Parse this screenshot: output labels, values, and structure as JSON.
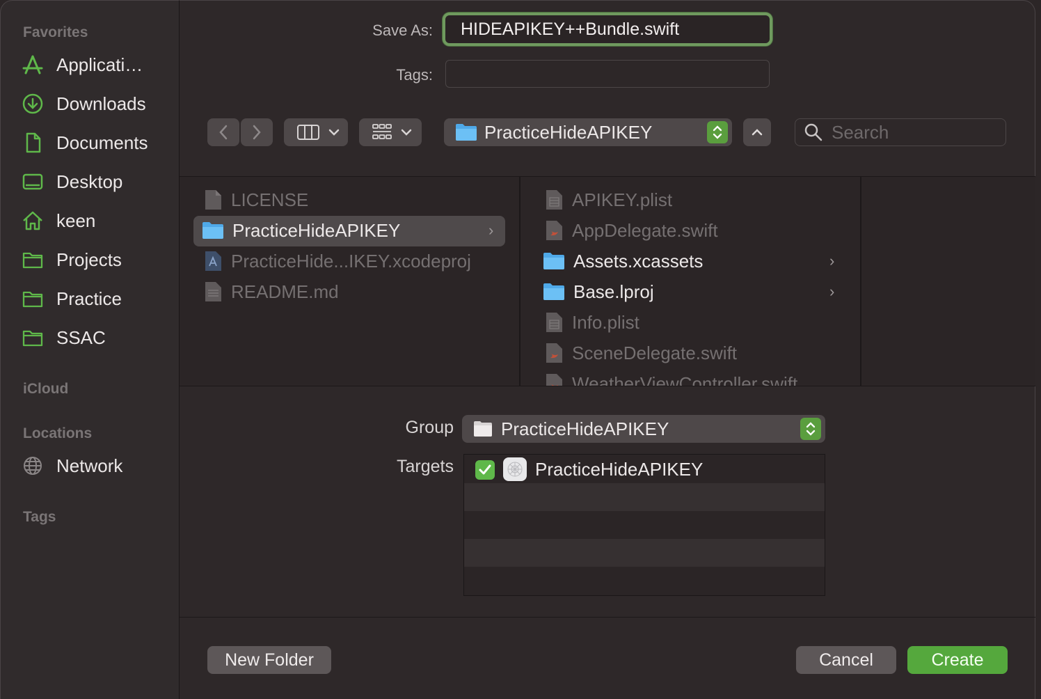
{
  "sidebar": {
    "favorites_header": "Favorites",
    "favorites": [
      {
        "label": "Applicati…",
        "icon": "applications-icon"
      },
      {
        "label": "Downloads",
        "icon": "downloads-icon"
      },
      {
        "label": "Documents",
        "icon": "documents-icon"
      },
      {
        "label": "Desktop",
        "icon": "desktop-icon"
      },
      {
        "label": "keen",
        "icon": "home-icon"
      },
      {
        "label": "Projects",
        "icon": "folder-icon"
      },
      {
        "label": "Practice",
        "icon": "folder-icon"
      },
      {
        "label": "SSAC",
        "icon": "folder-icon"
      }
    ],
    "icloud_header": "iCloud",
    "locations_header": "Locations",
    "locations": [
      {
        "label": "Network",
        "icon": "network-icon"
      }
    ],
    "tags_header": "Tags"
  },
  "form": {
    "save_as_label": "Save As:",
    "save_as_value": "HIDEAPIKEY++Bundle.swift",
    "tags_label": "Tags:",
    "tags_value": ""
  },
  "toolbar": {
    "path_label": "PracticeHideAPIKEY",
    "search_placeholder": "Search"
  },
  "browser": {
    "column1": [
      {
        "name": "LICENSE",
        "type": "file",
        "enabled": false
      },
      {
        "name": "PracticeHideAPIKEY",
        "type": "folder",
        "enabled": true,
        "selected": true
      },
      {
        "name": "PracticeHide...IKEY.xcodeproj",
        "type": "xcodeproj",
        "enabled": false
      },
      {
        "name": "README.md",
        "type": "file",
        "enabled": false
      }
    ],
    "column2": [
      {
        "name": "APIKEY.plist",
        "type": "plist",
        "enabled": false
      },
      {
        "name": "AppDelegate.swift",
        "type": "swift",
        "enabled": false
      },
      {
        "name": "Assets.xcassets",
        "type": "folder",
        "enabled": true
      },
      {
        "name": "Base.lproj",
        "type": "folder",
        "enabled": true
      },
      {
        "name": "Info.plist",
        "type": "plist",
        "enabled": false
      },
      {
        "name": "SceneDelegate.swift",
        "type": "swift",
        "enabled": false
      },
      {
        "name": "WeatherViewController.swift",
        "type": "swift",
        "enabled": false
      }
    ]
  },
  "options": {
    "group_label": "Group",
    "group_value": "PracticeHideAPIKEY",
    "targets_label": "Targets",
    "targets": [
      {
        "name": "PracticeHideAPIKEY",
        "checked": true
      }
    ]
  },
  "buttons": {
    "new_folder": "New Folder",
    "cancel": "Cancel",
    "create": "Create"
  },
  "colors": {
    "accent_green": "#55a83d",
    "focus_ring": "#6f9a5e",
    "folder_blue": "#4fa9e8"
  }
}
